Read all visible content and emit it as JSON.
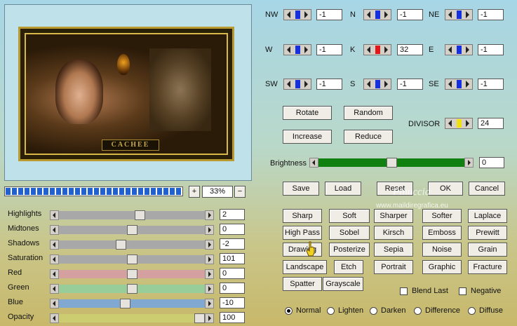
{
  "matrix": {
    "cells": [
      {
        "key": "nw",
        "label": "NW",
        "value": "-1",
        "marker": "#1530e0"
      },
      {
        "key": "n",
        "label": "N",
        "value": "-1",
        "marker": "#1530e0"
      },
      {
        "key": "ne",
        "label": "NE",
        "value": "-1",
        "marker": "#1530e0"
      },
      {
        "key": "w",
        "label": "W",
        "value": "-1",
        "marker": "#1530e0"
      },
      {
        "key": "k",
        "label": "K",
        "value": "32",
        "marker": "#e01818"
      },
      {
        "key": "e",
        "label": "E",
        "value": "-1",
        "marker": "#1530e0"
      },
      {
        "key": "sw",
        "label": "SW",
        "value": "-1",
        "marker": "#1530e0"
      },
      {
        "key": "s",
        "label": "S",
        "value": "-1",
        "marker": "#1530e0"
      },
      {
        "key": "se",
        "label": "SE",
        "value": "-1",
        "marker": "#1530e0"
      }
    ]
  },
  "actions": {
    "rotate": "Rotate",
    "random": "Random",
    "increase": "Increase",
    "reduce": "Reduce"
  },
  "divisor": {
    "label": "DIVISOR",
    "value": "24",
    "marker": "#f0e010"
  },
  "brightness": {
    "label": "Brightness",
    "value": "0",
    "level": 0.5
  },
  "main_buttons": {
    "save": "Save",
    "load": "Load",
    "reset": "Reset",
    "ok": "OK",
    "cancel": "Cancel"
  },
  "watermark": {
    "name": "Pinuccia",
    "site": "www.maildiregrafica.eu"
  },
  "preview": {
    "caption": "CACHEE",
    "zoom": "33%",
    "zoom_in": "+",
    "zoom_out": "−",
    "progress": 1.0
  },
  "presets": [
    [
      "Sharp",
      "Soft",
      "Sharper",
      "Softer",
      "Laplace"
    ],
    [
      "High Pass",
      "Sobel",
      "Kirsch",
      "Emboss",
      "Prewitt"
    ],
    [
      "Drawing",
      "Posterize",
      "Sepia",
      "Noise",
      "Grain"
    ],
    [
      "Landscape",
      "Etch",
      "Portrait",
      "Graphic",
      "Fracture"
    ],
    [
      "Spatter",
      "Grayscale"
    ]
  ],
  "options": {
    "blend_last": "Blend Last",
    "negative": "Negative"
  },
  "blend_modes": {
    "items": [
      "Normal",
      "Lighten",
      "Darken",
      "Difference",
      "Diffuse"
    ],
    "selected": "Normal"
  },
  "adjustments": [
    {
      "label": "Highlights",
      "value": "2",
      "level": 0.56,
      "track": "#a8a8a8"
    },
    {
      "label": "Midtones",
      "value": "0",
      "level": 0.5,
      "track": "#a8a8a8"
    },
    {
      "label": "Shadows",
      "value": "-2",
      "level": 0.42,
      "track": "#a8a8a8"
    },
    {
      "label": "Saturation",
      "value": "101",
      "level": 0.5,
      "track": "#a8a8a8"
    },
    {
      "label": "Red",
      "value": "0",
      "level": 0.5,
      "track": "#d4a0a0"
    },
    {
      "label": "Green",
      "value": "0",
      "level": 0.5,
      "track": "#98cc98"
    },
    {
      "label": "Blue",
      "value": "-10",
      "level": 0.45,
      "track": "#80a8d0"
    },
    {
      "label": "Opacity",
      "value": "100",
      "level": 1.0,
      "track": "#cccc70"
    }
  ]
}
